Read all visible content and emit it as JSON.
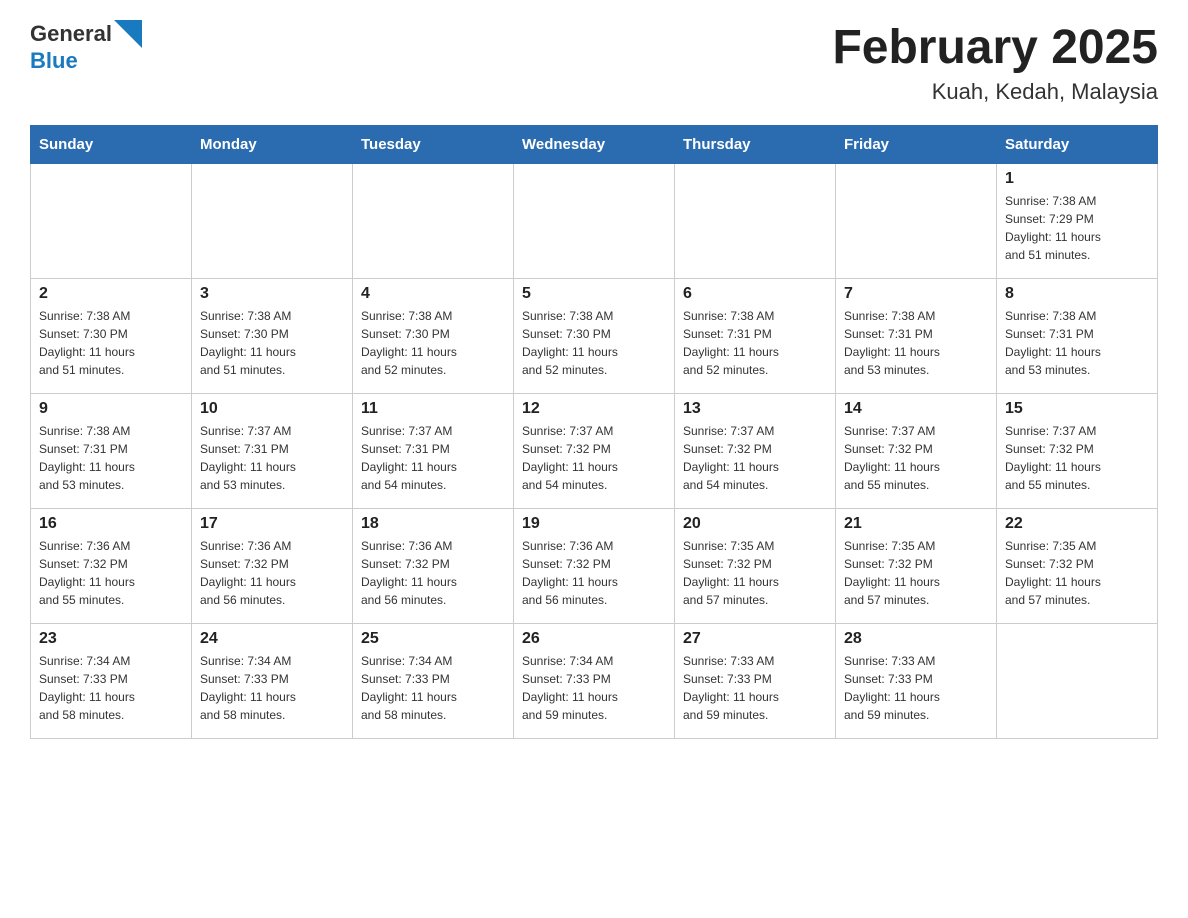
{
  "header": {
    "logo_general": "General",
    "logo_blue": "Blue",
    "title": "February 2025",
    "subtitle": "Kuah, Kedah, Malaysia"
  },
  "weekdays": [
    "Sunday",
    "Monday",
    "Tuesday",
    "Wednesday",
    "Thursday",
    "Friday",
    "Saturday"
  ],
  "weeks": [
    [
      {
        "day": "",
        "info": ""
      },
      {
        "day": "",
        "info": ""
      },
      {
        "day": "",
        "info": ""
      },
      {
        "day": "",
        "info": ""
      },
      {
        "day": "",
        "info": ""
      },
      {
        "day": "",
        "info": ""
      },
      {
        "day": "1",
        "info": "Sunrise: 7:38 AM\nSunset: 7:29 PM\nDaylight: 11 hours\nand 51 minutes."
      }
    ],
    [
      {
        "day": "2",
        "info": "Sunrise: 7:38 AM\nSunset: 7:30 PM\nDaylight: 11 hours\nand 51 minutes."
      },
      {
        "day": "3",
        "info": "Sunrise: 7:38 AM\nSunset: 7:30 PM\nDaylight: 11 hours\nand 51 minutes."
      },
      {
        "day": "4",
        "info": "Sunrise: 7:38 AM\nSunset: 7:30 PM\nDaylight: 11 hours\nand 52 minutes."
      },
      {
        "day": "5",
        "info": "Sunrise: 7:38 AM\nSunset: 7:30 PM\nDaylight: 11 hours\nand 52 minutes."
      },
      {
        "day": "6",
        "info": "Sunrise: 7:38 AM\nSunset: 7:31 PM\nDaylight: 11 hours\nand 52 minutes."
      },
      {
        "day": "7",
        "info": "Sunrise: 7:38 AM\nSunset: 7:31 PM\nDaylight: 11 hours\nand 53 minutes."
      },
      {
        "day": "8",
        "info": "Sunrise: 7:38 AM\nSunset: 7:31 PM\nDaylight: 11 hours\nand 53 minutes."
      }
    ],
    [
      {
        "day": "9",
        "info": "Sunrise: 7:38 AM\nSunset: 7:31 PM\nDaylight: 11 hours\nand 53 minutes."
      },
      {
        "day": "10",
        "info": "Sunrise: 7:37 AM\nSunset: 7:31 PM\nDaylight: 11 hours\nand 53 minutes."
      },
      {
        "day": "11",
        "info": "Sunrise: 7:37 AM\nSunset: 7:31 PM\nDaylight: 11 hours\nand 54 minutes."
      },
      {
        "day": "12",
        "info": "Sunrise: 7:37 AM\nSunset: 7:32 PM\nDaylight: 11 hours\nand 54 minutes."
      },
      {
        "day": "13",
        "info": "Sunrise: 7:37 AM\nSunset: 7:32 PM\nDaylight: 11 hours\nand 54 minutes."
      },
      {
        "day": "14",
        "info": "Sunrise: 7:37 AM\nSunset: 7:32 PM\nDaylight: 11 hours\nand 55 minutes."
      },
      {
        "day": "15",
        "info": "Sunrise: 7:37 AM\nSunset: 7:32 PM\nDaylight: 11 hours\nand 55 minutes."
      }
    ],
    [
      {
        "day": "16",
        "info": "Sunrise: 7:36 AM\nSunset: 7:32 PM\nDaylight: 11 hours\nand 55 minutes."
      },
      {
        "day": "17",
        "info": "Sunrise: 7:36 AM\nSunset: 7:32 PM\nDaylight: 11 hours\nand 56 minutes."
      },
      {
        "day": "18",
        "info": "Sunrise: 7:36 AM\nSunset: 7:32 PM\nDaylight: 11 hours\nand 56 minutes."
      },
      {
        "day": "19",
        "info": "Sunrise: 7:36 AM\nSunset: 7:32 PM\nDaylight: 11 hours\nand 56 minutes."
      },
      {
        "day": "20",
        "info": "Sunrise: 7:35 AM\nSunset: 7:32 PM\nDaylight: 11 hours\nand 57 minutes."
      },
      {
        "day": "21",
        "info": "Sunrise: 7:35 AM\nSunset: 7:32 PM\nDaylight: 11 hours\nand 57 minutes."
      },
      {
        "day": "22",
        "info": "Sunrise: 7:35 AM\nSunset: 7:32 PM\nDaylight: 11 hours\nand 57 minutes."
      }
    ],
    [
      {
        "day": "23",
        "info": "Sunrise: 7:34 AM\nSunset: 7:33 PM\nDaylight: 11 hours\nand 58 minutes."
      },
      {
        "day": "24",
        "info": "Sunrise: 7:34 AM\nSunset: 7:33 PM\nDaylight: 11 hours\nand 58 minutes."
      },
      {
        "day": "25",
        "info": "Sunrise: 7:34 AM\nSunset: 7:33 PM\nDaylight: 11 hours\nand 58 minutes."
      },
      {
        "day": "26",
        "info": "Sunrise: 7:34 AM\nSunset: 7:33 PM\nDaylight: 11 hours\nand 59 minutes."
      },
      {
        "day": "27",
        "info": "Sunrise: 7:33 AM\nSunset: 7:33 PM\nDaylight: 11 hours\nand 59 minutes."
      },
      {
        "day": "28",
        "info": "Sunrise: 7:33 AM\nSunset: 7:33 PM\nDaylight: 11 hours\nand 59 minutes."
      },
      {
        "day": "",
        "info": ""
      }
    ]
  ]
}
